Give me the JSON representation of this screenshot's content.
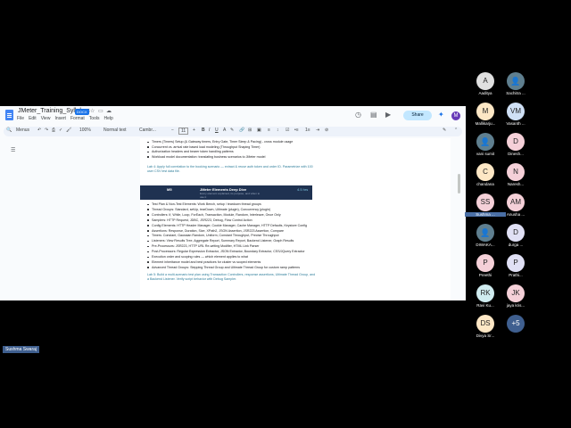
{
  "document": {
    "title": "JMeter_Training_Syllabus",
    "badge": "DOCX",
    "menu": [
      "File",
      "Edit",
      "View",
      "Insert",
      "Format",
      "Tools",
      "Help"
    ],
    "share_label": "Share",
    "avatar_letter": "M",
    "toolbar": {
      "menus": "Menus",
      "zoom": "100%",
      "style": "Normal text",
      "font": "Cambr...",
      "font_size": "11"
    },
    "content": {
      "lines_top": [
        "Timers (Timers) Setup (& Gateway timers, Entry Gate, Timer Sleep & Pacing) - cross module usage",
        "Concurrent vs. arrival rate based load modeling (Throughput Shaping Timer)",
        "Authorization headers and bearer token handling patterns",
        "Workload model documentation: translating business scenarios to JMeter model"
      ],
      "lab4": "Lab 4: Apply full correlation to the booking scenario — extract & reuse auth token and order ID. Parametrize with 100 user CSV test data file.",
      "module5": {
        "num": "M5",
        "title": "JMeter Elements Deep Dive",
        "subtitle": "Every element explained, its purpose, and when to use it",
        "hours": "4.5 hrs"
      },
      "lines_bottom": [
        "Test Plan & Non-Test Elements: Work Bench, setup / teardown thread groups",
        "Thread Groups: Standard, setUp, tearDown, Ultimate (plugin), Concurrency (plugin)",
        "Controllers: If, While, Loop, ForEach, Transaction, Module, Random, Interleave, Once Only",
        "Samplers: HTTP Request, JDBC, JSR223, Debug, Flow Control Action",
        "Config Elements: HTTP Header Manager, Cookie Manager, Cache Manager, HTTP Defaults, Keystore Config",
        "Assertions: Response, Duration, Size, XPath2, JSON Assertion, JSR223 Assertion, Compare",
        "Timers: Constant, Gaussian Random, Uniform, Constant Throughput, Precise Throughput",
        "Listeners: View Results Tree, Aggregate Report, Summary Report, Backend Listener, Graph Results",
        "Pre-Processors: JSR223, HTTP URL Re-writing Modifier, HTML Link Parser",
        "Post-Processors: Regular Expression Extractor, JSON Extractor, Boundary Extractor, CSS/JQuery Extractor",
        "Execution order and scoping rules — which element applies to what",
        "Element inheritance model and best practices for cluster vs scoped elements",
        "Advanced Thread Groups: Stepping Thread Group and Ultimate Thread Group for custom ramp patterns"
      ],
      "lab5": "Lab 5: Build a multi-scenario test plan using Transaction Controllers, response assertions, Ultimate Thread Group, and a Backend Listener. Verify script behavior with Debug Sampler."
    }
  },
  "participants": [
    {
      "initials": "A",
      "name": "Aaditya",
      "color": "#e0e0e0"
    },
    {
      "initials": "",
      "name": "Sachitra ...",
      "color": "#5f7f8f"
    },
    {
      "initials": "M",
      "name": "Mallikarju...",
      "color": "#fde7c5"
    },
    {
      "initials": "VM",
      "name": "Vasanth ...",
      "color": "#cfe0f5"
    },
    {
      "initials": "",
      "name": "vani sumit",
      "color": "#5f7f8f"
    },
    {
      "initials": "D",
      "name": "Dinesh...",
      "color": "#f5d0d8"
    },
    {
      "initials": "C",
      "name": "chandana",
      "color": "#fde7c5"
    },
    {
      "initials": "N",
      "name": "Naresh...",
      "color": "#f5d0d8"
    },
    {
      "initials": "SS",
      "name": "Sushma ...",
      "color": "#f5d0d8"
    },
    {
      "initials": "AM",
      "name": "Anusha ...",
      "color": "#f5d0d8"
    },
    {
      "initials": "",
      "name": "DIWAKA...",
      "color": "#5f7f8f"
    },
    {
      "initials": "D",
      "name": "durga ...",
      "color": "#e0e0f5"
    },
    {
      "initials": "P",
      "name": "Preethi",
      "color": "#f5d0d8"
    },
    {
      "initials": "P",
      "name": "Prathi...",
      "color": "#e0e0f5"
    },
    {
      "initials": "RK",
      "name": "Ravi Ku...",
      "color": "#d0ecf0"
    },
    {
      "initials": "JK",
      "name": "jaya kris...",
      "color": "#f5d0d8"
    },
    {
      "initials": "DS",
      "name": "Divya Sr...",
      "color": "#fde7c5"
    },
    {
      "initials": "+5",
      "name": "",
      "color": "#3f5f8f"
    }
  ],
  "self_label": "Sushma Swaraj"
}
